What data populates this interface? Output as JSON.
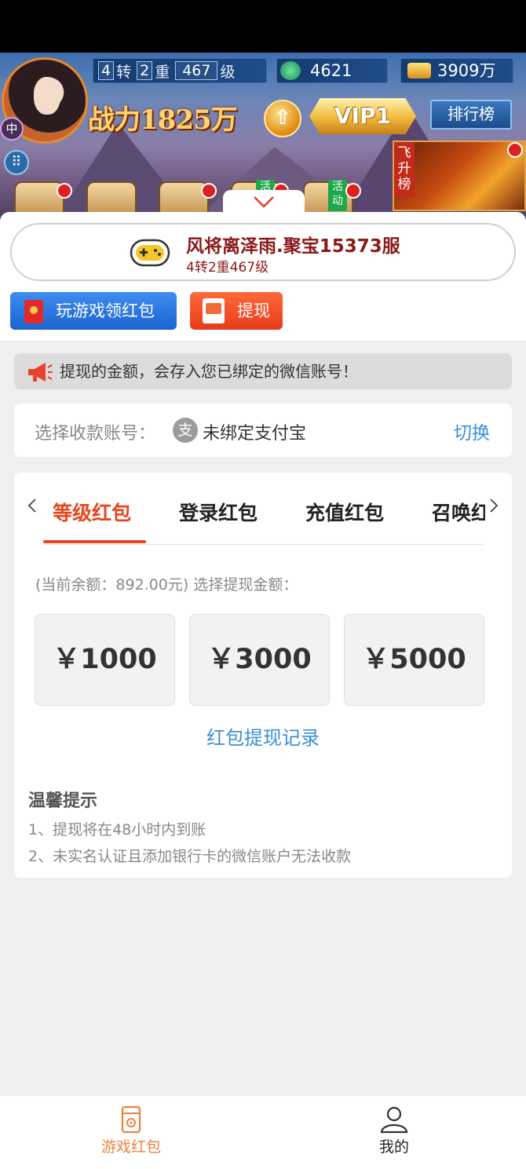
{
  "banner": {
    "level": {
      "turn": "4",
      "turn_unit": "转",
      "tier": "2",
      "tier_unit": "重",
      "level": "467",
      "level_unit": "级"
    },
    "gem_count": "4621",
    "gold_count": "3909万",
    "combat_power": "战力1825万",
    "vip": "VIP1",
    "rank_button": "排行榜",
    "server_badge": "中",
    "feisheng": "飞升榜",
    "activity_tags": [
      "活动",
      "活动"
    ]
  },
  "header": {
    "game_name": "风将离泽雨.聚宝15373服",
    "game_level": "4转2重467级",
    "play_button": "玩游戏领红包",
    "withdraw_button": "提现"
  },
  "notice": "提现的金额，会存入您已绑定的微信账号！",
  "account": {
    "label": "选择收款账号：",
    "alipay_glyph": "支",
    "value": "未绑定支付宝",
    "switch": "切换"
  },
  "tabs": [
    {
      "label": "等级红包",
      "active": true
    },
    {
      "label": "登录红包",
      "active": false
    },
    {
      "label": "充值红包",
      "active": false
    },
    {
      "label": "召唤红包",
      "active": false
    }
  ],
  "balance_text": "(当前余额：892.00元) 选择提现金额：",
  "amounts": [
    "￥1000",
    "￥3000",
    "￥5000"
  ],
  "records_link": "红包提现记录",
  "tips": {
    "title": "温馨提示",
    "items": [
      "1、提现将在48小时内到账",
      "2、未实名认证且添加银行卡的微信账户无法收款"
    ]
  },
  "bottom_nav": [
    {
      "label": "游戏红包",
      "icon": "red-packet-icon",
      "active": true
    },
    {
      "label": "我的",
      "icon": "user-icon",
      "active": false
    }
  ],
  "colors": {
    "accent": "#e6461c",
    "link": "#3a8fd8",
    "primary_button": "#1c63d0",
    "withdraw_button": "#e83a1a",
    "nav_active": "#e8823c"
  }
}
